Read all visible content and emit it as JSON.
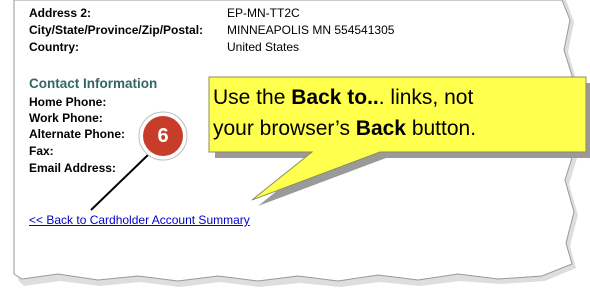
{
  "details": [
    {
      "label": "Address 2:",
      "value": "EP-MN-TT2C"
    },
    {
      "label": "City/State/Province/Zip/Postal:",
      "value": "MINNEAPOLIS MN 554541305"
    },
    {
      "label": "Country:",
      "value": "United States"
    }
  ],
  "contact": {
    "heading": "Contact Information",
    "fields": [
      "Home Phone:",
      "Work Phone:",
      "Alternate Phone:",
      "Fax:",
      "Email Address:"
    ]
  },
  "back_link": "<< Back to Cardholder Account Summary",
  "callout": {
    "line1_pre": "Use the ",
    "line1_bold": "Back to..",
    "line1_post": ". links, not",
    "line2_pre": "your browser’s ",
    "line2_bold": "Back",
    "line2_post": " button."
  },
  "step_number": "6",
  "colors": {
    "callout_fill": "#ffff4d",
    "callout_shadow": "#9a9a9a",
    "step_badge": "#c83c2a",
    "section_heading": "#336666",
    "link": "#0000cc"
  }
}
